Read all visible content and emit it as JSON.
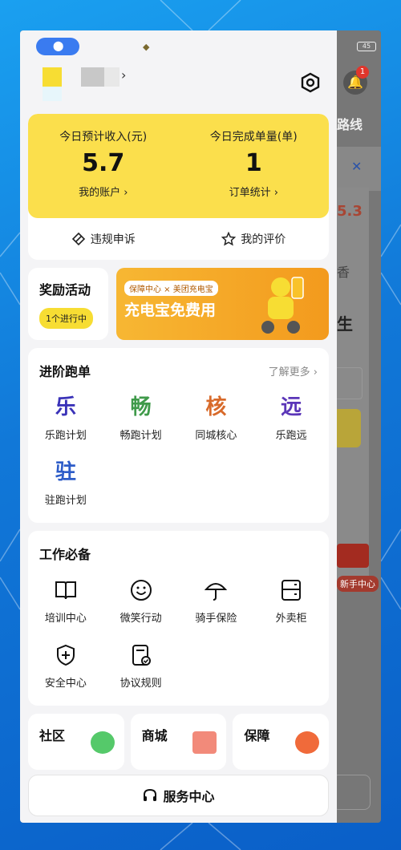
{
  "status": {
    "battery": "45",
    "notification_count": "1"
  },
  "underlay": {
    "route_label": "路线",
    "amount": "5.3",
    "text_xiang": "香",
    "text_sheng": "生",
    "newbie": "新手中心"
  },
  "income": {
    "left_label": "今日预计收入(元)",
    "left_value": "5.7",
    "left_link": "我的账户 ›",
    "right_label": "今日完成单量(单)",
    "right_value": "1",
    "right_link": "订单统计 ›",
    "appeal": "违规申诉",
    "review": "我的评价"
  },
  "reward": {
    "title": "奖励活动",
    "pill": "1个进行中"
  },
  "banner": {
    "tag": "保障中心 × 美团充电宝",
    "headline": "充电宝免费用"
  },
  "advanced": {
    "title": "进阶跑单",
    "more": "了解更多 ›",
    "items": [
      {
        "glyph": "乐",
        "label": "乐跑计划",
        "color": "#3a32b8"
      },
      {
        "glyph": "畅",
        "label": "畅跑计划",
        "color": "#3f9a4a"
      },
      {
        "glyph": "核",
        "label": "同城核心",
        "color": "#d86a2a"
      },
      {
        "glyph": "远",
        "label": "乐跑远",
        "color": "#5b36b8"
      },
      {
        "glyph": "驻",
        "label": "驻跑计划",
        "color": "#2d5cc8"
      }
    ]
  },
  "work": {
    "title": "工作必备",
    "items": [
      {
        "label": "培训中心",
        "icon": "book-icon"
      },
      {
        "label": "微笑行动",
        "icon": "smile-icon"
      },
      {
        "label": "骑手保险",
        "icon": "umbrella-icon"
      },
      {
        "label": "外卖柜",
        "icon": "cabinet-icon"
      },
      {
        "label": "安全中心",
        "icon": "shield-plus-icon"
      },
      {
        "label": "协议规则",
        "icon": "document-check-icon"
      }
    ]
  },
  "bottom_cards": [
    {
      "title": "社区",
      "color": "#55c96a"
    },
    {
      "title": "商城",
      "color": "#f28a7a"
    },
    {
      "title": "保障",
      "color": "#f06a3a"
    }
  ],
  "service": {
    "label": "服务中心"
  }
}
